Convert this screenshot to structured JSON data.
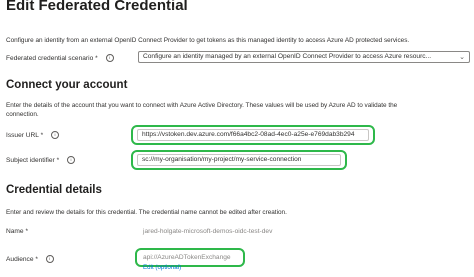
{
  "header": {
    "title": "Edit Federated Credential",
    "more_label": "···"
  },
  "intro": "Configure an identity from an external OpenID Connect Provider to get tokens as this managed identity to access Azure AD protected services.",
  "scenario": {
    "label": "Federated credential scenario",
    "required": "*",
    "value": "Configure an identity managed by an external OpenID Connect Provider to access Azure resourc..."
  },
  "connect_section": {
    "title": "Connect your account",
    "description_line1": "Enter the details of the account that you want to connect with Azure Active Directory. These values will be used by Azure AD to validate the",
    "description_line2": "connection."
  },
  "issuer": {
    "label": "Issuer URL",
    "required": "*",
    "value": "https://vstoken.dev.azure.com/f66a4bc2-08ad-4ec0-a25e-e769dab3b294"
  },
  "subject": {
    "label": "Subject identifier",
    "required": "*",
    "value": "sc://my-organisation/my-project/my-service-connection"
  },
  "credential_section": {
    "title": "Credential details",
    "description": "Enter and review the details for this credential. The credential name cannot be edited after creation."
  },
  "name": {
    "label": "Name",
    "required": "*",
    "value": "jared-holgate-microsoft-demos-oidc-test-dev"
  },
  "audience": {
    "label": "Audience",
    "required": "*",
    "value": "api://AzureADTokenExchange",
    "edit_link": "Edit (optional)"
  },
  "icons": {
    "info": "i",
    "chevron": "⌄"
  },
  "colors": {
    "highlight": "#2eb84a",
    "link": "#0078d4"
  }
}
